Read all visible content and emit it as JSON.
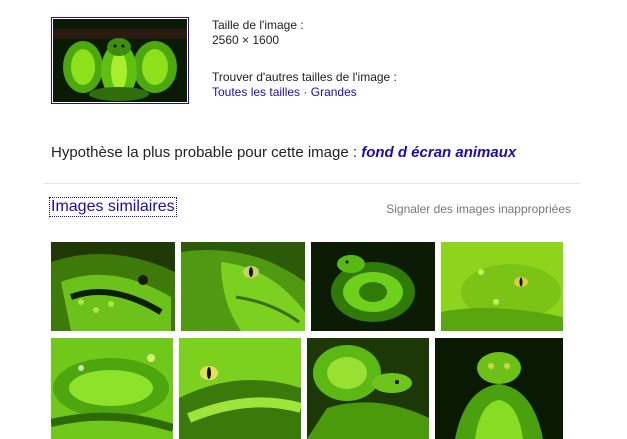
{
  "main_image": {
    "alt": "green snake"
  },
  "info": {
    "size_label": "Taille de l'image :",
    "size_value": "2560 × 1600",
    "other_sizes_label": "Trouver d'autres tailles de l'image :",
    "all_sizes_link": "Toutes les tailles",
    "separator": "·",
    "large_link": "Grandes"
  },
  "hypothesis": {
    "prefix": "Hypothèse la plus probable pour cette image :",
    "best_guess": "fond d écran animaux"
  },
  "similar": {
    "heading": "Images similaires",
    "report_link": "Signaler des images inappropriées"
  },
  "colors": {
    "link": "#1a0dab",
    "snake_light": "#9be01a",
    "snake_dark": "#1e4a06"
  }
}
